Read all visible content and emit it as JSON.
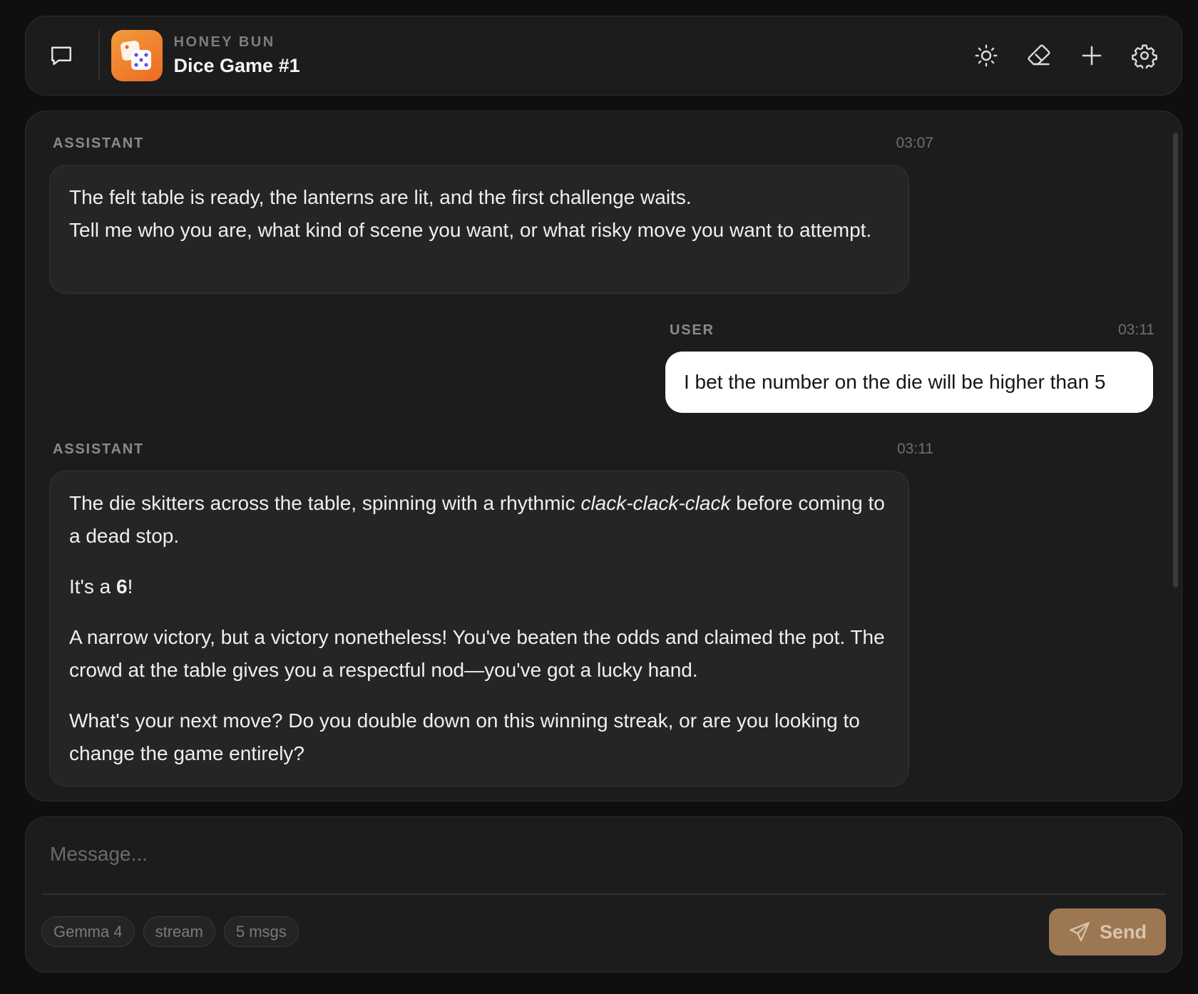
{
  "header": {
    "app_name": "HONEY BUN",
    "chat_title": "Dice Game #1",
    "icons": {
      "chat_toggle": "chat-bubble-icon",
      "app_logo": "dice-icon",
      "theme": "sun-icon",
      "clear": "eraser-icon",
      "new_chat": "plus-icon",
      "settings": "gear-icon"
    }
  },
  "messages": [
    {
      "role": "ASSISTANT",
      "time": "03:07",
      "lines": [
        "The felt table is ready, the lanterns are lit, and the first challenge waits.",
        "Tell me who you are, what kind of scene you want, or what risky move you want to attempt."
      ]
    },
    {
      "role": "USER",
      "time": "03:11",
      "text": "I bet the number on the die will be higher than 5"
    },
    {
      "role": "ASSISTANT",
      "time": "03:11",
      "p1_before": "The die skitters across the table, spinning with a rhythmic ",
      "p1_em": "clack-clack-clack",
      "p1_after": " before coming to a dead stop.",
      "p2_before": "It's a ",
      "p2_strong": "6",
      "p2_after": "!",
      "p3": "A narrow victory, but a victory nonetheless! You've beaten the odds and claimed the pot. The crowd at the table gives you a respectful nod—you've got a lucky hand.",
      "p4": "What's your next move? Do you double down on this winning streak, or are you looking to change the game entirely?"
    }
  ],
  "composer": {
    "placeholder": "Message...",
    "value": "",
    "chips": [
      "Gemma 4",
      "stream",
      "5 msgs"
    ],
    "send_label": "Send",
    "send_icon": "paper-plane-icon"
  },
  "colors": {
    "background": "#0f0f10",
    "panel": "#1c1c1d",
    "assistant_bubble": "#252526",
    "user_bubble": "#ffffff",
    "send_button": "#9d7652",
    "app_icon_gradient": [
      "#f49b3c",
      "#ec6a24"
    ]
  }
}
